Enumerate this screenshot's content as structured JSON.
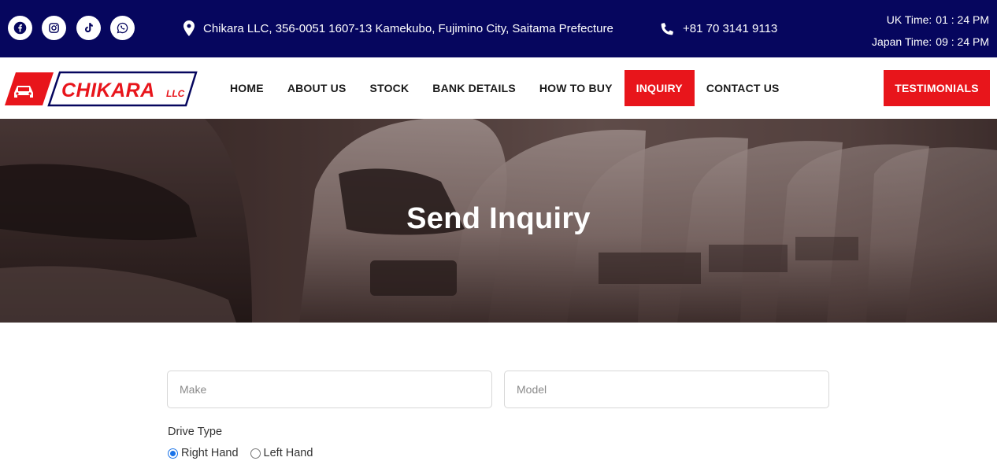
{
  "topbar": {
    "social": [
      {
        "name": "facebook-icon"
      },
      {
        "name": "instagram-icon"
      },
      {
        "name": "tiktok-icon"
      },
      {
        "name": "whatsapp-icon"
      }
    ],
    "address": "Chikara LLC, 356-0051 1607-13 Kamekubo, Fujimino City, Saitama Prefecture",
    "phone": "+81 70 3141 9113",
    "uk_time_label": "UK Time:",
    "uk_time_value": "01 : 24 PM",
    "japan_time_label": "Japan Time:",
    "japan_time_value": "09 : 24 PM"
  },
  "logo": {
    "name": "CHIKARA",
    "suffix": "LLC"
  },
  "nav": {
    "items": [
      "HOME",
      "ABOUT US",
      "STOCK",
      "BANK DETAILS",
      "HOW TO BUY",
      "INQUIRY",
      "CONTACT US"
    ],
    "active": "INQUIRY",
    "cta": "TESTIMONIALS"
  },
  "hero": {
    "title": "Send Inquiry"
  },
  "form": {
    "make_placeholder": "Make",
    "model_placeholder": "Model",
    "drive_type_label": "Drive Type",
    "drive_options": [
      "Right Hand",
      "Left Hand"
    ],
    "drive_selected": "Right Hand"
  },
  "colors": {
    "topbar": "#06065e",
    "accent": "#e8151b",
    "radio": "#1a73e8"
  }
}
